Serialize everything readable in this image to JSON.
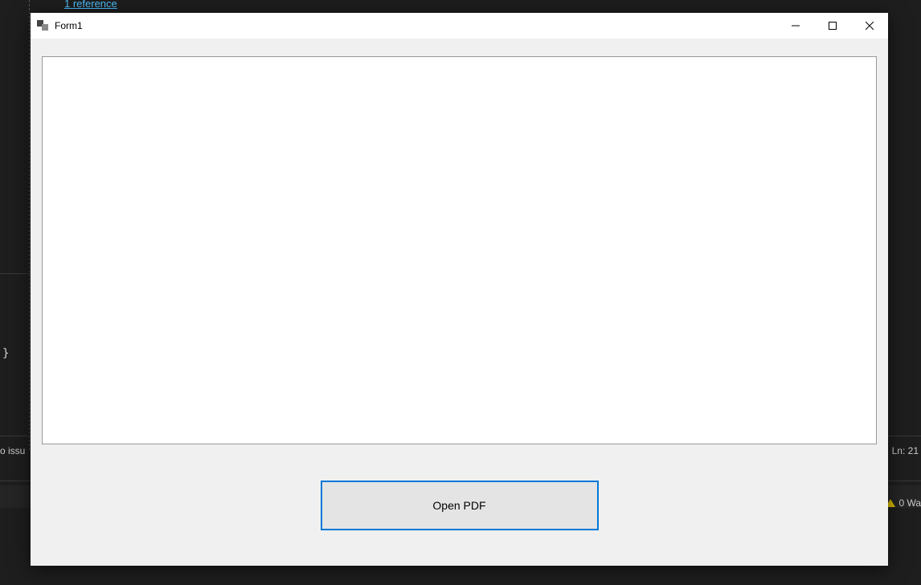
{
  "background": {
    "reference_link": "1 reference",
    "brace": "}",
    "issues_fragment": "o issu",
    "ln_fragment": "Ln: 21",
    "warnings_fragment": "0 Wa"
  },
  "form": {
    "title": "Form1",
    "open_pdf_label": "Open PDF"
  }
}
